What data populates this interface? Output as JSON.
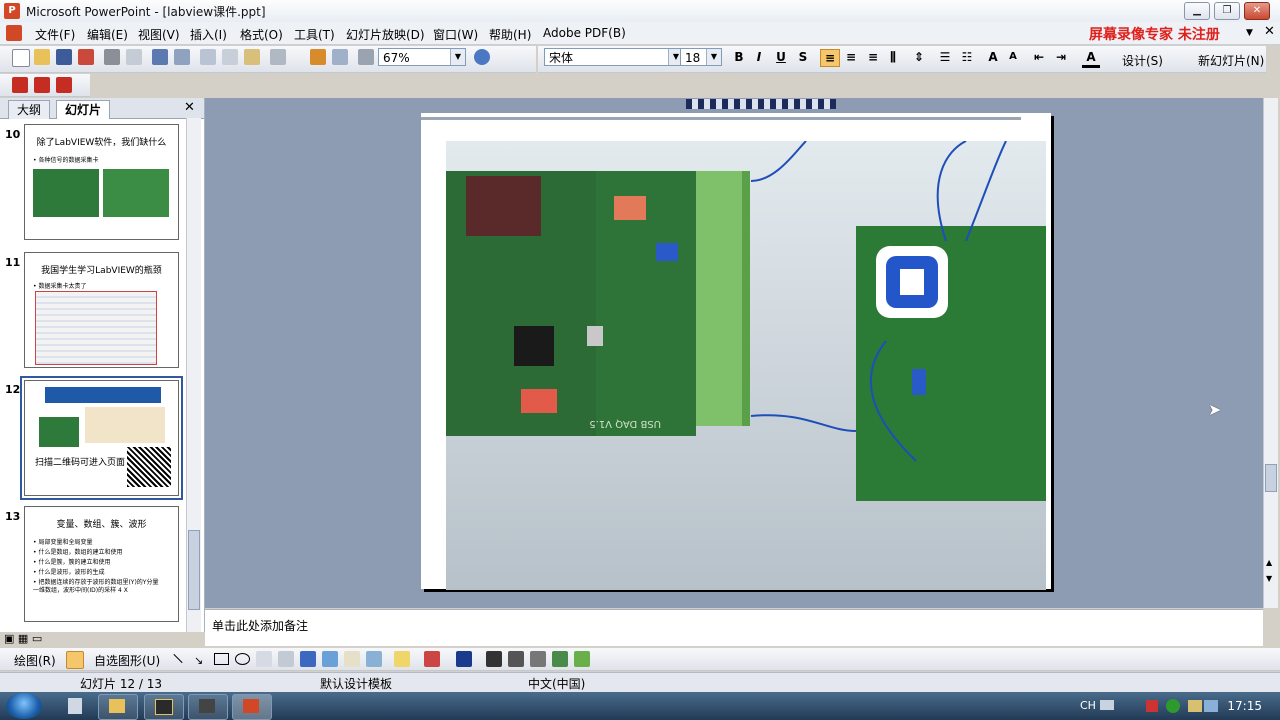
{
  "window": {
    "title": "Microsoft PowerPoint - [labview课件.ppt]",
    "app_icon": "P"
  },
  "menu": {
    "items": [
      "文件(F)",
      "编辑(E)",
      "视图(V)",
      "插入(I)",
      "格式(O)",
      "工具(T)",
      "幻灯片放映(D)",
      "窗口(W)",
      "帮助(H)",
      "Adobe PDF(B)"
    ],
    "promo": "屏幕录像专家 未注册"
  },
  "toolbar": {
    "zoom": "67%",
    "font_name": "宋体",
    "font_size": "18",
    "design_label": "设计(S)",
    "new_slide_label": "新幻灯片(N)"
  },
  "leftpane": {
    "tabs": [
      "大纲",
      "幻灯片"
    ],
    "slides": [
      {
        "num": "10",
        "title": "除了LabVIEW软件，我们缺什么",
        "bullets": [
          "• 各种信号的数据采集卡"
        ]
      },
      {
        "num": "11",
        "title": "我国学生学习LabVIEW的瓶颈",
        "bullets": [
          "• 数据采集卡太贵了"
        ]
      },
      {
        "num": "12",
        "title": "扫描二维码可进入页面",
        "bullets": []
      },
      {
        "num": "13",
        "title": "变量、数组、簇、波形",
        "bullets": [
          "• 局部变量和全局变量",
          "• 什么是数组，数组的建立和使用",
          "• 什么是簇，簇的建立和使用",
          "• 什么是波形，波形的生成",
          "• 把数据连续的存放于波形的数组里(Y)的Y分量",
          "  一维数组，波形中间(ID)的采样 4 X"
        ]
      }
    ]
  },
  "slide": {
    "board_label": "USB DAQ V1.5"
  },
  "notes": {
    "placeholder": "单击此处添加备注"
  },
  "drawbar": {
    "draw_label": "绘图(R)",
    "autoshape_label": "自选图形(U)"
  },
  "status": {
    "slide_count": "幻灯片 12 / 13",
    "template": "默认设计模板",
    "language": "中文(中国)"
  },
  "taskbar": {
    "lang": "CH",
    "time": "17:15"
  }
}
